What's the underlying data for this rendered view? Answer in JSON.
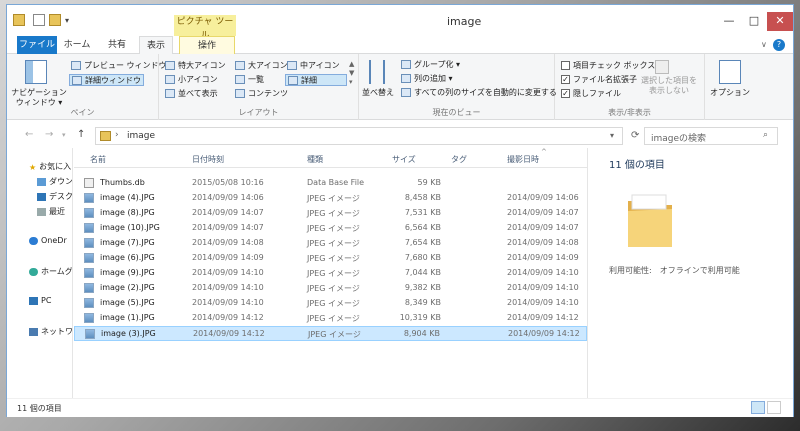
{
  "window": {
    "title": "image",
    "context_tab_header": "ピクチャ ツール",
    "min": "—",
    "max": "□",
    "close": "✕"
  },
  "tabs": {
    "file": "ファイル",
    "home": "ホーム",
    "share": "共有",
    "view": "表示",
    "manage": "操作"
  },
  "ribbon": {
    "pane": {
      "label": "ペイン",
      "nav_pane": "ナビゲーション\nウィンドウ ▾",
      "preview": "プレビュー ウィンドウ",
      "details": "詳細ウィンドウ"
    },
    "layout": {
      "label": "レイアウト",
      "xl_icons": "特大アイコン",
      "large_icons": "大アイコン",
      "medium_icons": "中アイコン",
      "small_icons": "小アイコン",
      "list": "一覧",
      "details": "詳細",
      "tiles": "並べて表示",
      "content": "コンテンツ"
    },
    "current_view": {
      "label": "現在のビュー",
      "sort": "並べ替え",
      "group_by": "グループ化 ▾",
      "add_columns": "列の追加 ▾",
      "size_all": "すべての列のサイズを自動的に変更する"
    },
    "show_hide": {
      "label": "表示/非表示",
      "item_checkboxes": "項目チェック ボックス",
      "file_ext": "ファイル名拡張子",
      "hidden": "隠しファイル",
      "hide_selected": "選択した項目を\n表示しない"
    },
    "options": "オプション"
  },
  "address": {
    "path": "image",
    "search_placeholder": "imageの検索",
    "back": "←",
    "forward": "→",
    "up": "↑",
    "refresh": "⟳"
  },
  "nav_pane": {
    "items": [
      {
        "label": "お気に入り",
        "icon": "star-icon"
      },
      {
        "label": "ダウン",
        "icon": "download-folder-icon"
      },
      {
        "label": "デスク",
        "icon": "desktop-icon"
      },
      {
        "label": "最近",
        "icon": "recent-icon"
      },
      {
        "label": "OneDr",
        "icon": "cloud-icon"
      },
      {
        "label": "ホームグ",
        "icon": "homegroup-icon"
      },
      {
        "label": "PC",
        "icon": "pc-icon"
      },
      {
        "label": "ネットワ",
        "icon": "network-icon"
      }
    ]
  },
  "columns": {
    "name": "名前",
    "date": "日付時刻",
    "type": "種類",
    "size": "サイズ",
    "tag": "タグ",
    "taken": "撮影日時"
  },
  "files": [
    {
      "name": "Thumbs.db",
      "date": "2015/05/08 10:16",
      "type": "Data Base File",
      "size": "59 KB",
      "taken": "",
      "kind": "db"
    },
    {
      "name": "image (4).JPG",
      "date": "2014/09/09 14:06",
      "type": "JPEG イメージ",
      "size": "8,458 KB",
      "taken": "2014/09/09 14:06",
      "kind": "img"
    },
    {
      "name": "image (8).JPG",
      "date": "2014/09/09 14:07",
      "type": "JPEG イメージ",
      "size": "7,531 KB",
      "taken": "2014/09/09 14:07",
      "kind": "img"
    },
    {
      "name": "image (10).JPG",
      "date": "2014/09/09 14:07",
      "type": "JPEG イメージ",
      "size": "6,564 KB",
      "taken": "2014/09/09 14:07",
      "kind": "img"
    },
    {
      "name": "image (7).JPG",
      "date": "2014/09/09 14:08",
      "type": "JPEG イメージ",
      "size": "7,654 KB",
      "taken": "2014/09/09 14:08",
      "kind": "img"
    },
    {
      "name": "image (6).JPG",
      "date": "2014/09/09 14:09",
      "type": "JPEG イメージ",
      "size": "7,680 KB",
      "taken": "2014/09/09 14:09",
      "kind": "img"
    },
    {
      "name": "image (9).JPG",
      "date": "2014/09/09 14:10",
      "type": "JPEG イメージ",
      "size": "7,044 KB",
      "taken": "2014/09/09 14:10",
      "kind": "img"
    },
    {
      "name": "image (2).JPG",
      "date": "2014/09/09 14:10",
      "type": "JPEG イメージ",
      "size": "9,382 KB",
      "taken": "2014/09/09 14:10",
      "kind": "img"
    },
    {
      "name": "image (5).JPG",
      "date": "2014/09/09 14:10",
      "type": "JPEG イメージ",
      "size": "8,349 KB",
      "taken": "2014/09/09 14:10",
      "kind": "img"
    },
    {
      "name": "image (1).JPG",
      "date": "2014/09/09 14:12",
      "type": "JPEG イメージ",
      "size": "10,319 KB",
      "taken": "2014/09/09 14:12",
      "kind": "img"
    },
    {
      "name": "image (3).JPG",
      "date": "2014/09/09 14:12",
      "type": "JPEG イメージ",
      "size": "8,904 KB",
      "taken": "2014/09/09 14:12",
      "kind": "img",
      "selected": true
    }
  ],
  "details_pane": {
    "title": "11 個の項目",
    "availability": "利用可能性:　オフラインで利用可能"
  },
  "status": {
    "count": "11 個の項目"
  },
  "colors": {
    "accent": "#1979ca",
    "selection": "#cce8ff",
    "context_tab": "#f7ef9c"
  }
}
